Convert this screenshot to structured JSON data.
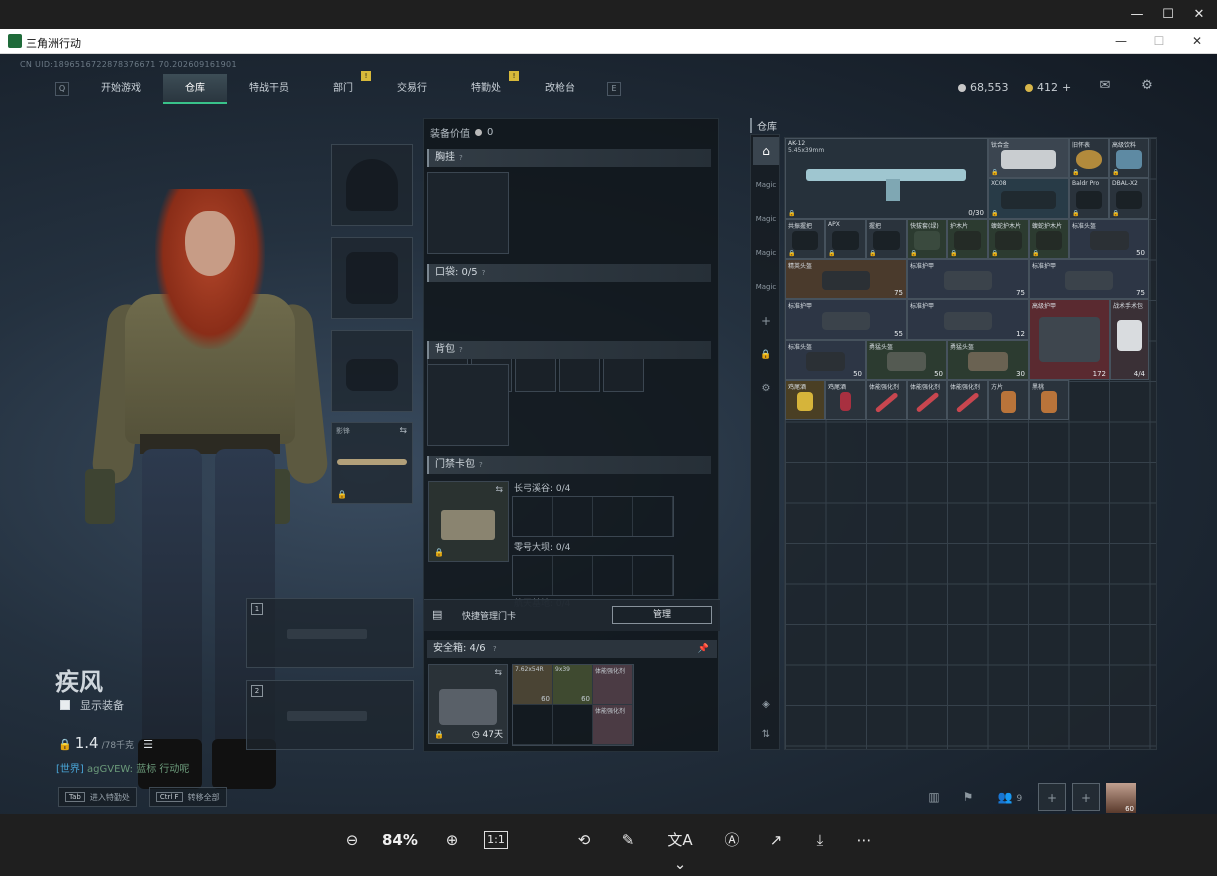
{
  "app": {
    "title": "三角洲行动"
  },
  "uid": "CN UID:1896516722878376671 70.202609161901",
  "nav": {
    "left_key": "Q",
    "right_key": "E",
    "tabs": [
      {
        "label": "开始游戏",
        "active": false,
        "badge": ""
      },
      {
        "label": "仓库",
        "active": true,
        "badge": ""
      },
      {
        "label": "特战干员",
        "active": false,
        "badge": ""
      },
      {
        "label": "部门",
        "active": false,
        "badge": "!"
      },
      {
        "label": "交易行",
        "active": false,
        "badge": ""
      },
      {
        "label": "特勤处",
        "active": false,
        "badge": "!"
      },
      {
        "label": "改枪台",
        "active": false,
        "badge": ""
      }
    ]
  },
  "currency": {
    "silver": "68,553",
    "gold": "412",
    "plus": "+"
  },
  "character": {
    "name": "疾风",
    "show_equipment": "显示装备",
    "weight": "1.4",
    "weight_max": "/78千克",
    "chat_channel": "[世界]",
    "chat_text": "agGVEW: 蓝标 行动呢"
  },
  "hotkeys": [
    {
      "key": "Tab",
      "label": "进入特勤处"
    },
    {
      "key": "Ctrl F",
      "label": "转移全部"
    }
  ],
  "gear_slots": {
    "knife_label": "影锋",
    "weapon_slot_1": "1",
    "weapon_slot_2": "2"
  },
  "equipment": {
    "value_label": "装备价值",
    "value": "0",
    "chest_rig": "胸挂",
    "pockets": "口袋: 0/5",
    "backpack": "背包",
    "keycard_pack": "门禁卡包",
    "key_zones": [
      "长弓溪谷: 0/4",
      "零号大坝: 0/4",
      "航天基地: 0/4"
    ],
    "quick_manage": "快捷管理门卡",
    "manage_button": "管理",
    "safe_box": "安全箱: 4/6",
    "safe_timer": "47天",
    "safe_items": [
      "7.62x54R",
      "9x39",
      "体能强化剂",
      "体能强化剂"
    ],
    "safe_counts": [
      "60",
      "60",
      "",
      ""
    ]
  },
  "warehouse": {
    "title": "仓库",
    "side_tabs": [
      "Magic",
      "Magic",
      "Magic",
      "Magic"
    ],
    "items": [
      {
        "name": "AK-12",
        "sub": "5.45x39mm",
        "count": "0/30"
      },
      {
        "name": "钛合金",
        "count": ""
      },
      {
        "name": "旧怀表",
        "count": ""
      },
      {
        "name": "高级饮料",
        "count": ""
      },
      {
        "name": "XC08",
        "count": ""
      },
      {
        "name": "Baldr Pro",
        "count": ""
      },
      {
        "name": "DBAL-X2",
        "count": ""
      },
      {
        "name": "共振握把",
        "count": ""
      },
      {
        "name": "APX",
        "count": ""
      },
      {
        "name": "握把",
        "count": ""
      },
      {
        "name": "快拔套(绿)",
        "count": ""
      },
      {
        "name": "护木片",
        "count": ""
      },
      {
        "name": "蝮蛇护木片",
        "count": ""
      },
      {
        "name": "蝮蛇护木片",
        "count": ""
      },
      {
        "name": "标准头盔",
        "count": "50"
      },
      {
        "name": "精英头盔",
        "count": "75"
      },
      {
        "name": "标准护甲",
        "count": "75"
      },
      {
        "name": "标准护甲",
        "count": "75"
      },
      {
        "name": "标准护甲",
        "count": "55"
      },
      {
        "name": "标准护甲",
        "count": "12"
      },
      {
        "name": "高级护甲",
        "count": "172"
      },
      {
        "name": "战术手术包",
        "count": "4/4"
      },
      {
        "name": "标准头盔",
        "count": "50"
      },
      {
        "name": "勇猛头盔",
        "count": "50"
      },
      {
        "name": "勇猛头盔",
        "count": "30"
      },
      {
        "name": "鸡尾酒",
        "count": ""
      },
      {
        "name": "鸡尾酒",
        "count": ""
      },
      {
        "name": "体能强化剂",
        "count": ""
      },
      {
        "name": "体能强化剂",
        "count": ""
      },
      {
        "name": "体能强化剂",
        "count": ""
      },
      {
        "name": "方片",
        "count": ""
      },
      {
        "name": "黑桃",
        "count": ""
      }
    ]
  },
  "social": {
    "friends": "9",
    "avatar_level": "60"
  },
  "viewer": {
    "zoom": "84%",
    "actual_size": "1:1"
  },
  "colors": {
    "accent": "#39c28a",
    "badge": "#d7b93a"
  }
}
